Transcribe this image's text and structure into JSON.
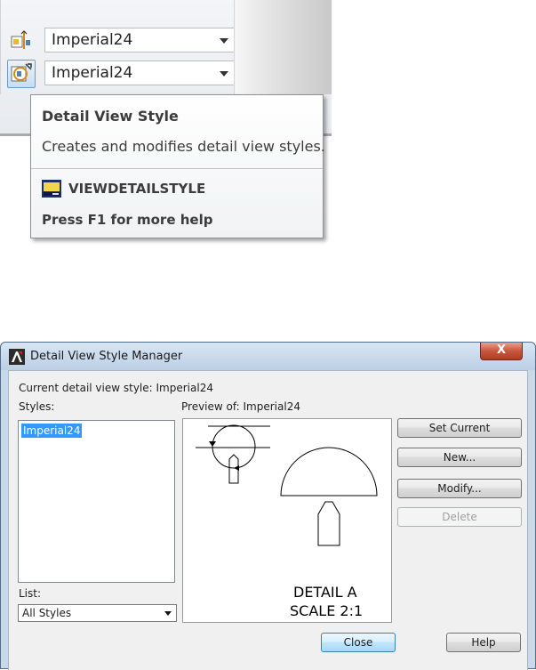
{
  "ribbon": {
    "combo1_value": "Imperial24",
    "combo2_value": "Imperial24",
    "icon1": "section-view-style-icon",
    "icon2": "detail-view-style-icon"
  },
  "tooltip": {
    "title": "Detail View Style",
    "description": "Creates and modifies detail view styles.",
    "command": "VIEWDETAILSTYLE",
    "help": "Press F1 for more help",
    "command_icon": "command-window-icon"
  },
  "dialog": {
    "title": "Detail View Style Manager",
    "close_glyph": "X",
    "current_label": "Current detail view style: Imperial24",
    "styles_label": "Styles:",
    "styles_items": [
      "Imperial24"
    ],
    "preview_label": "Preview of: Imperial24",
    "list_label": "List:",
    "list_value": "All Styles",
    "preview_text_line1": "DETAIL A",
    "preview_text_line2": "SCALE 2:1",
    "buttons": {
      "set_current": "Set Current",
      "new": "New...",
      "modify": "Modify...",
      "delete": "Delete",
      "close": "Close",
      "help": "Help"
    }
  },
  "colors": {
    "selection": "#3399ff",
    "title_close": "#c8573f",
    "dialog_frame": "#c9d9ea"
  }
}
